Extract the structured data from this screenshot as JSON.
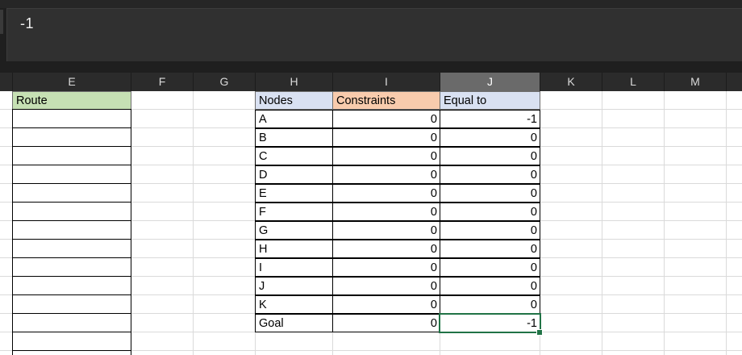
{
  "formula_bar": {
    "value": "-1"
  },
  "columns": [
    "E",
    "F",
    "G",
    "H",
    "I",
    "J",
    "K",
    "L",
    "M"
  ],
  "selected_column": "J",
  "route_header": "Route",
  "table": {
    "headers": {
      "nodes": "Nodes",
      "constraints": "Constraints",
      "equal_to": "Equal to"
    },
    "rows": [
      {
        "node": "A",
        "constraint": "0",
        "equal": "-1"
      },
      {
        "node": "B",
        "constraint": "0",
        "equal": "0"
      },
      {
        "node": "C",
        "constraint": "0",
        "equal": "0"
      },
      {
        "node": "D",
        "constraint": "0",
        "equal": "0"
      },
      {
        "node": "E",
        "constraint": "0",
        "equal": "0"
      },
      {
        "node": "F",
        "constraint": "0",
        "equal": "0"
      },
      {
        "node": "G",
        "constraint": "0",
        "equal": "0"
      },
      {
        "node": "H",
        "constraint": "0",
        "equal": "0"
      },
      {
        "node": "I",
        "constraint": "0",
        "equal": "0"
      },
      {
        "node": "J",
        "constraint": "0",
        "equal": "0"
      },
      {
        "node": "K",
        "constraint": "0",
        "equal": "0"
      },
      {
        "node": "Goal",
        "constraint": "0",
        "equal": "-1"
      }
    ]
  },
  "colors": {
    "route_header_fill": "#c6e0b4",
    "nodes_header_fill": "#d9e1f2",
    "constraints_header_fill": "#f8cbad",
    "equal_header_fill": "#d9e1f2",
    "selection": "#217346"
  }
}
